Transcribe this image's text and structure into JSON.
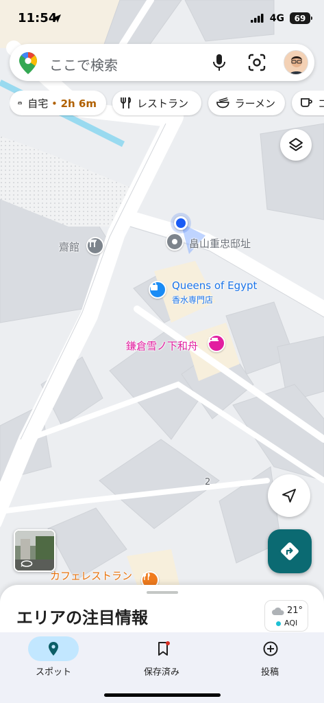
{
  "status_bar": {
    "time": "11:54",
    "network": "4G",
    "battery": "69"
  },
  "search": {
    "placeholder": "ここで検索"
  },
  "chips": {
    "home_label": "自宅",
    "home_separator": " • ",
    "home_eta": "2h 6m",
    "restaurant_label": "レストラン",
    "ramen_label": "ラーメン",
    "cafe_label": "コ"
  },
  "map": {
    "places": {
      "saikan": "齋館",
      "hatakeyama": "畠山重忠邸址",
      "queens_name": "Queens of Egypt",
      "queens_category": "香水専門店",
      "kamakura": "鎌倉雪ノ下和舟",
      "cafe": "カフェレストラン",
      "building_number": "2"
    },
    "colors": {
      "water": "#99daf0",
      "road": "#ffffff",
      "building": "#d9dce1",
      "location_dot": "#1a5cf5",
      "shop_pin": "#1a8cf5",
      "lodging_pin": "#e21fa0",
      "food_pin": "#f07c1e"
    }
  },
  "bottom_sheet": {
    "title": "エリアの注目情報",
    "temperature": "21°",
    "aqi_label": "AQI"
  },
  "bottom_nav": {
    "items": [
      {
        "label": "スポット",
        "icon": "location-pin-icon",
        "active": true
      },
      {
        "label": "保存済み",
        "icon": "bookmark-icon",
        "active": false
      },
      {
        "label": "投稿",
        "icon": "add-circle-icon",
        "active": false
      }
    ]
  },
  "colors": {
    "accent_teal": "#0b6a72",
    "eta_brown": "#b06000",
    "nav_active_pill": "#c2e7ff"
  }
}
